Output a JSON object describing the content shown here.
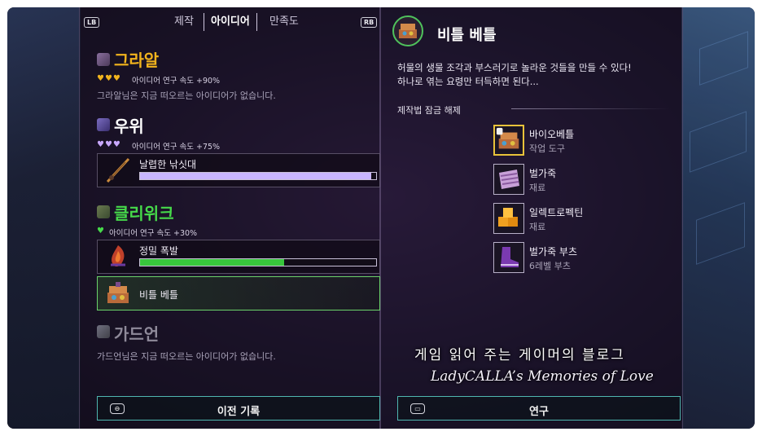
{
  "tabs": {
    "left_badge": "LB",
    "right_badge": "RB",
    "items": [
      "제작",
      "아이디어",
      "만족도"
    ],
    "active_index": 1
  },
  "characters": [
    {
      "name": "그라알",
      "color": "#f2b41d",
      "hearts": "♥♥♥",
      "heart_color": "#f2b41d",
      "stat": "아이디어 연구 속도 +90%",
      "no_idea": "그라알님은 지금 떠오르는 아이디어가 없습니다."
    },
    {
      "name": "우위",
      "color": "#ffffff",
      "hearts": "♥♥♥",
      "heart_color": "#c9a8ff",
      "stat": "아이디어 연구 속도 +75%",
      "idea": {
        "label": "날렵한 낚싯대",
        "progress": 0.98,
        "bar_color": "#c9b6ff"
      }
    },
    {
      "name": "클리위크",
      "color": "#46d94a",
      "hearts": "♥",
      "heart_color": "#46d94a",
      "stat": "아이디어 연구 속도 +30%",
      "ideas": [
        {
          "label": "정밀 폭발",
          "progress": 0.61,
          "bar_color": "#38c63c"
        },
        {
          "label": "비틀 베틀",
          "selected": true
        }
      ]
    },
    {
      "name": "가드언",
      "color": "#8f8a9a",
      "no_idea": "가드언님은 지금 떠오르는 아이디어가 없습니다."
    }
  ],
  "left_button": {
    "badge": "⊖",
    "label": "이전 기록"
  },
  "detail": {
    "title": "비틀 베틀",
    "desc_line1": "허물의 생물 조각과 부스러기로 놀라운 것들을 만들 수 있다!",
    "desc_line2": "하나로 엮는 요령만 터득하면 된다...",
    "unlock_header": "제작법 잠금 해제",
    "unlocks": [
      {
        "name": "바이오베틀",
        "type": "작업 도구",
        "icon": "loom-icon"
      },
      {
        "name": "벌가죽",
        "type": "재료",
        "icon": "leather-icon"
      },
      {
        "name": "일렉트로펙틴",
        "type": "재료",
        "icon": "pectin-icon"
      },
      {
        "name": "벌가죽 부츠",
        "type": "6레벨 부츠",
        "icon": "boots-icon"
      }
    ]
  },
  "right_button": {
    "badge": "▭",
    "label": "연구"
  },
  "watermark": {
    "line1": "게임 읽어 주는 게이머의 블로그",
    "line2": "LadyCALLA’s Memories of Love"
  }
}
